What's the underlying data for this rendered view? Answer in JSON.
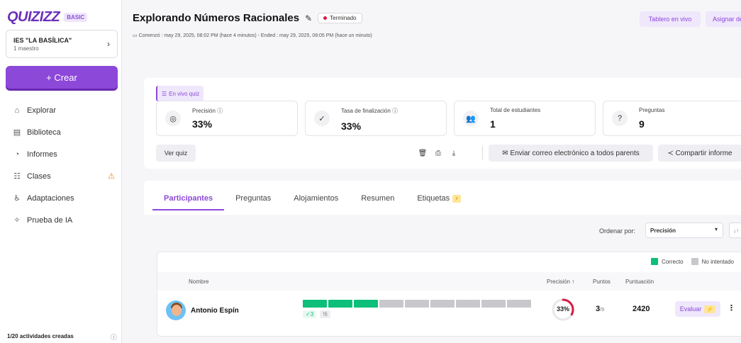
{
  "brand": {
    "logo": "QUIZIZZ",
    "plan": "BASIC"
  },
  "school": {
    "name": "IES \"LA BASÍLICA\"",
    "subtitle": "1 maestro"
  },
  "sidebar": {
    "create_label": "+ Crear",
    "items": [
      {
        "label": "Explorar",
        "icon": "home-icon"
      },
      {
        "label": "Biblioteca",
        "icon": "library-icon"
      },
      {
        "label": "Informes",
        "icon": "reports-icon"
      },
      {
        "label": "Clases",
        "icon": "classes-icon"
      },
      {
        "label": "Adaptaciones",
        "icon": "accommodations-icon"
      },
      {
        "label": "Prueba de IA",
        "icon": "ai-icon"
      }
    ],
    "activities": "1/20 actividades creadas"
  },
  "header": {
    "title": "Explorando Números Racionales",
    "status": "Terminado",
    "dates": "Comenzó : may 29, 2025, 08:02 PM (hace 4 minutos) - Ended : may 29, 2025, 08:05 PM (hace un minuto)",
    "live_board": "Tablero en vivo",
    "assign": "Asignar de nuevo"
  },
  "summary": {
    "live_tag": "En vivo quiz",
    "stats": [
      {
        "label": "Precisión",
        "value": "33%",
        "icon": "accuracy-icon"
      },
      {
        "label": "Tasa de finalización",
        "value": "33%",
        "icon": "check-circle-icon"
      },
      {
        "label": "Total de estudiantes",
        "value": "1",
        "icon": "students-icon"
      },
      {
        "label": "Preguntas",
        "value": "9",
        "icon": "question-icon"
      }
    ],
    "view_quiz": "Ver quiz",
    "email_all": "Enviar correo electrónico a todos parents",
    "share": "Compartir informe"
  },
  "tabs": [
    {
      "label": "Participantes"
    },
    {
      "label": "Preguntas"
    },
    {
      "label": "Alojamientos"
    },
    {
      "label": "Resumen"
    },
    {
      "label": "Etiquetas"
    }
  ],
  "sort": {
    "label": "Ordenar por:",
    "value": "Precisión"
  },
  "legend": {
    "correct": "Correcto",
    "not_attempted": "No intentado"
  },
  "table": {
    "headers": {
      "name": "Nombre",
      "accuracy": "Precisión",
      "points": "Puntos",
      "score": "Puntuación"
    },
    "rows": [
      {
        "name": "Antonio Espín",
        "correct": 3,
        "not_attempted": 6,
        "correct_badge": "✓3",
        "unattempted_badge": "!6",
        "accuracy": 0.33,
        "accuracy_label": "33%",
        "points": "3",
        "points_total": "/9",
        "score": "2420",
        "evaluate": "Evaluar"
      }
    ]
  },
  "colors": {
    "accent": "#8c48d9",
    "correct": "#0dbf78",
    "not_attempted": "#c8c8cc",
    "danger": "#d81b43"
  }
}
